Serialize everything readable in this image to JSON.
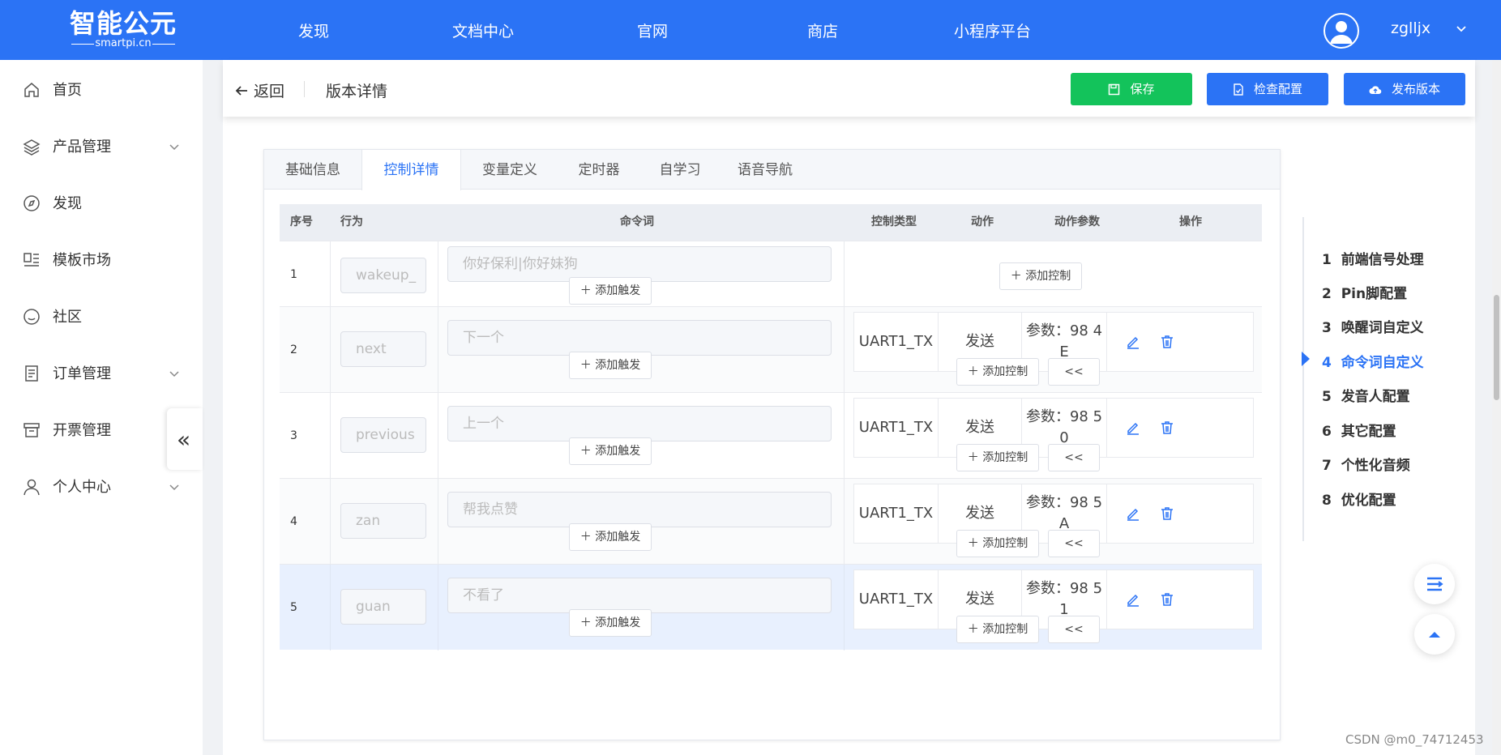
{
  "brand": {
    "name": "智能公元",
    "domain": "smartpi.cn"
  },
  "topnav": [
    "发现",
    "文档中心",
    "官网",
    "商店",
    "小程序平台"
  ],
  "user": {
    "name": "zglljx"
  },
  "sidebar": {
    "items": [
      {
        "label": "首页",
        "icon": "home-icon",
        "expandable": false
      },
      {
        "label": "产品管理",
        "icon": "layers-icon",
        "expandable": true
      },
      {
        "label": "发现",
        "icon": "compass-icon",
        "expandable": false
      },
      {
        "label": "模板市场",
        "icon": "template-icon",
        "expandable": false
      },
      {
        "label": "社区",
        "icon": "smile-icon",
        "expandable": false
      },
      {
        "label": "订单管理",
        "icon": "document-icon",
        "expandable": true
      },
      {
        "label": "开票管理",
        "icon": "box-icon",
        "expandable": true
      },
      {
        "label": "个人中心",
        "icon": "user-icon",
        "expandable": true
      }
    ],
    "collapse_glyph": "«"
  },
  "header": {
    "back_label": "返回",
    "title": "版本详情",
    "save_label": "保存",
    "check_label": "检查配置",
    "publish_label": "发布版本"
  },
  "tabs": [
    {
      "label": "基础信息",
      "active": false
    },
    {
      "label": "控制详情",
      "active": true
    },
    {
      "label": "变量定义",
      "active": false
    },
    {
      "label": "定时器",
      "active": false
    },
    {
      "label": "自学习",
      "active": false
    },
    {
      "label": "语音导航",
      "active": false
    }
  ],
  "table": {
    "columns": [
      "序号",
      "行为",
      "命令词",
      "控制类型",
      "动作",
      "动作参数",
      "操作"
    ],
    "add_trigger_label": "添加触发",
    "add_control_label": "添加控制",
    "collapse_label": "<<",
    "rows": [
      {
        "seq": "1",
        "action": "wakeup_",
        "command": "你好保利|你好妹狗",
        "controls": []
      },
      {
        "seq": "2",
        "action": "next",
        "command": "下一个",
        "controls": [
          {
            "type": "UART1_TX",
            "act": "发送",
            "param_line1": "参数：98 4",
            "param_line2": "E"
          }
        ]
      },
      {
        "seq": "3",
        "action": "previous",
        "command": "上一个",
        "controls": [
          {
            "type": "UART1_TX",
            "act": "发送",
            "param_line1": "参数：98 5",
            "param_line2": "0"
          }
        ]
      },
      {
        "seq": "4",
        "action": "zan",
        "command": "帮我点赞",
        "controls": [
          {
            "type": "UART1_TX",
            "act": "发送",
            "param_line1": "参数：98 5",
            "param_line2": "A"
          }
        ]
      },
      {
        "seq": "5",
        "action": "guan",
        "command": "不看了",
        "controls": [
          {
            "type": "UART1_TX",
            "act": "发送",
            "param_line1": "参数：98 5",
            "param_line2": "1"
          }
        ],
        "highlighted": true
      }
    ]
  },
  "anchor_nav": [
    {
      "num": "1",
      "label": "前端信号处理",
      "active": false
    },
    {
      "num": "2",
      "label": "Pin脚配置",
      "active": false
    },
    {
      "num": "3",
      "label": "唤醒词自定义",
      "active": false
    },
    {
      "num": "4",
      "label": "命令词自定义",
      "active": true
    },
    {
      "num": "5",
      "label": "发音人配置",
      "active": false
    },
    {
      "num": "6",
      "label": "其它配置",
      "active": false
    },
    {
      "num": "7",
      "label": "个性化音频",
      "active": false
    },
    {
      "num": "8",
      "label": "优化配置",
      "active": false
    }
  ],
  "watermark": "CSDN @m0_74712453",
  "colors": {
    "primary": "#2b73f5",
    "save": "#13c35b",
    "highlight_row": "#e8f0fe"
  }
}
